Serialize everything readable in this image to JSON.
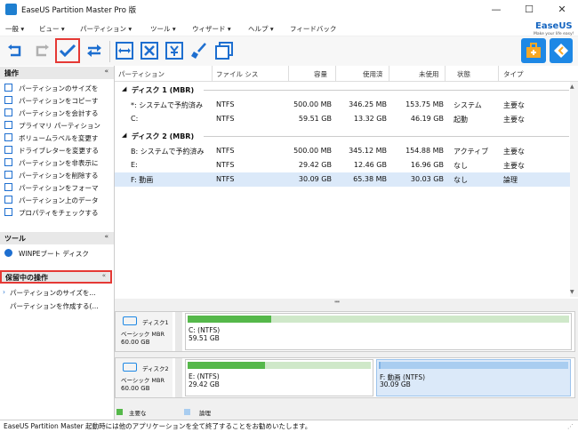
{
  "window": {
    "title": "EaseUS Partition Master Pro 版",
    "minimize_glyph": "—",
    "maximize_glyph": "☐",
    "close_glyph": "✕"
  },
  "menu": [
    {
      "label": "一般 ▾"
    },
    {
      "label": "ビュー ▾"
    },
    {
      "label": "パーティション ▾"
    },
    {
      "label": "ツール ▾"
    },
    {
      "label": "ウィザード ▾"
    },
    {
      "label": "ヘルプ ▾"
    },
    {
      "label": "フィードバック"
    }
  ],
  "logo": {
    "text": "EaseUS",
    "sub": "Make your life easy!"
  },
  "toolbar": {
    "icons": [
      "undo-icon",
      "redo-icon",
      "apply-check-icon",
      "refresh-icon",
      "resize-partition-icon",
      "delete-partition-icon",
      "merge-partition-icon",
      "wipe-icon",
      "copy-partition-icon",
      "toolbox-icon",
      "navigation-icon"
    ],
    "accent": "#1e6fd0",
    "highlight": "#e53935"
  },
  "left": {
    "operations_title": "操作",
    "operations": [
      {
        "label": "パーティションのサイズを",
        "icon": "resize-icon"
      },
      {
        "label": "パーティションをコピーす",
        "icon": "copy-icon"
      },
      {
        "label": "パーティションを会計する",
        "icon": "merge-icon"
      },
      {
        "label": "プライマリ パーティション",
        "icon": "primary-icon"
      },
      {
        "label": "ボリュームラベルを変更す",
        "icon": "label-icon"
      },
      {
        "label": "ドライブレターを変更する",
        "icon": "drive-letter-icon"
      },
      {
        "label": "パーティションを非表示に",
        "icon": "hide-icon"
      },
      {
        "label": "パーティションを削除する",
        "icon": "delete-icon"
      },
      {
        "label": "パーティションをフォーマ",
        "icon": "format-icon"
      },
      {
        "label": "パーティション上のデータ",
        "icon": "wipe-data-icon"
      },
      {
        "label": "プロパティをチェックする",
        "icon": "properties-icon"
      }
    ],
    "tools_title": "ツール",
    "tools": [
      {
        "label": "WINPEブート ディスク",
        "icon": "winpe-icon"
      }
    ],
    "pending_title": "保留中の操作",
    "pending": [
      {
        "label": "パーティションのサイズを..."
      },
      {
        "label": "パーティションを作成する(..."
      }
    ]
  },
  "table": {
    "columns": [
      "パーティション",
      "ファイル シス",
      "容量",
      "使用済",
      "未使用",
      "状態",
      "タイプ"
    ],
    "disks": [
      {
        "title": "ディスク 1 (MBR)",
        "rows": [
          {
            "name": "*: システムで予約済み",
            "fs": "NTFS",
            "capacity": "500.00 MB",
            "used": "346.25 MB",
            "free": "153.75 MB",
            "status": "システム",
            "type": "主要な"
          },
          {
            "name": "C:",
            "fs": "NTFS",
            "capacity": "59.51 GB",
            "used": "13.32 GB",
            "free": "46.19 GB",
            "status": "起動",
            "type": "主要な"
          }
        ]
      },
      {
        "title": "ディスク 2 (MBR)",
        "rows": [
          {
            "name": "B: システムで予約済み",
            "fs": "NTFS",
            "capacity": "500.00 MB",
            "used": "345.12 MB",
            "free": "154.88 MB",
            "status": "アクティブ",
            "type": "主要な"
          },
          {
            "name": "E:",
            "fs": "NTFS",
            "capacity": "29.42 GB",
            "used": "12.46 GB",
            "free": "16.96 GB",
            "status": "なし",
            "type": "主要な"
          },
          {
            "name": "F: 動画",
            "fs": "NTFS",
            "capacity": "30.09 GB",
            "used": "65.38 MB",
            "free": "30.03 GB",
            "status": "なし",
            "type": "論理"
          }
        ]
      }
    ]
  },
  "diskmap": [
    {
      "name": "ディスク1",
      "type": "ベーシック MBR",
      "size": "60.00 GB",
      "partitions": [
        {
          "name": "C: (NTFS)",
          "size": "59.51 GB",
          "used_fraction": 0.22,
          "selected": false
        }
      ]
    },
    {
      "name": "ディスク2",
      "type": "ベーシック MBR",
      "size": "60.00 GB",
      "partitions": [
        {
          "name": "E: (NTFS)",
          "size": "29.42 GB",
          "used_fraction": 0.42,
          "selected": false
        },
        {
          "name": "F: 動画 (NTFS)",
          "size": "30.09 GB",
          "used_fraction": 0.01,
          "selected": true
        }
      ]
    }
  ],
  "legend": [
    {
      "label": "主要な",
      "color": "#55b84a"
    },
    {
      "label": "論理",
      "color": "#a9cdf0"
    }
  ],
  "status": "EaseUS Partition Master 起動時には他のアプリケーションを全て終了することをお勧めいたします。"
}
